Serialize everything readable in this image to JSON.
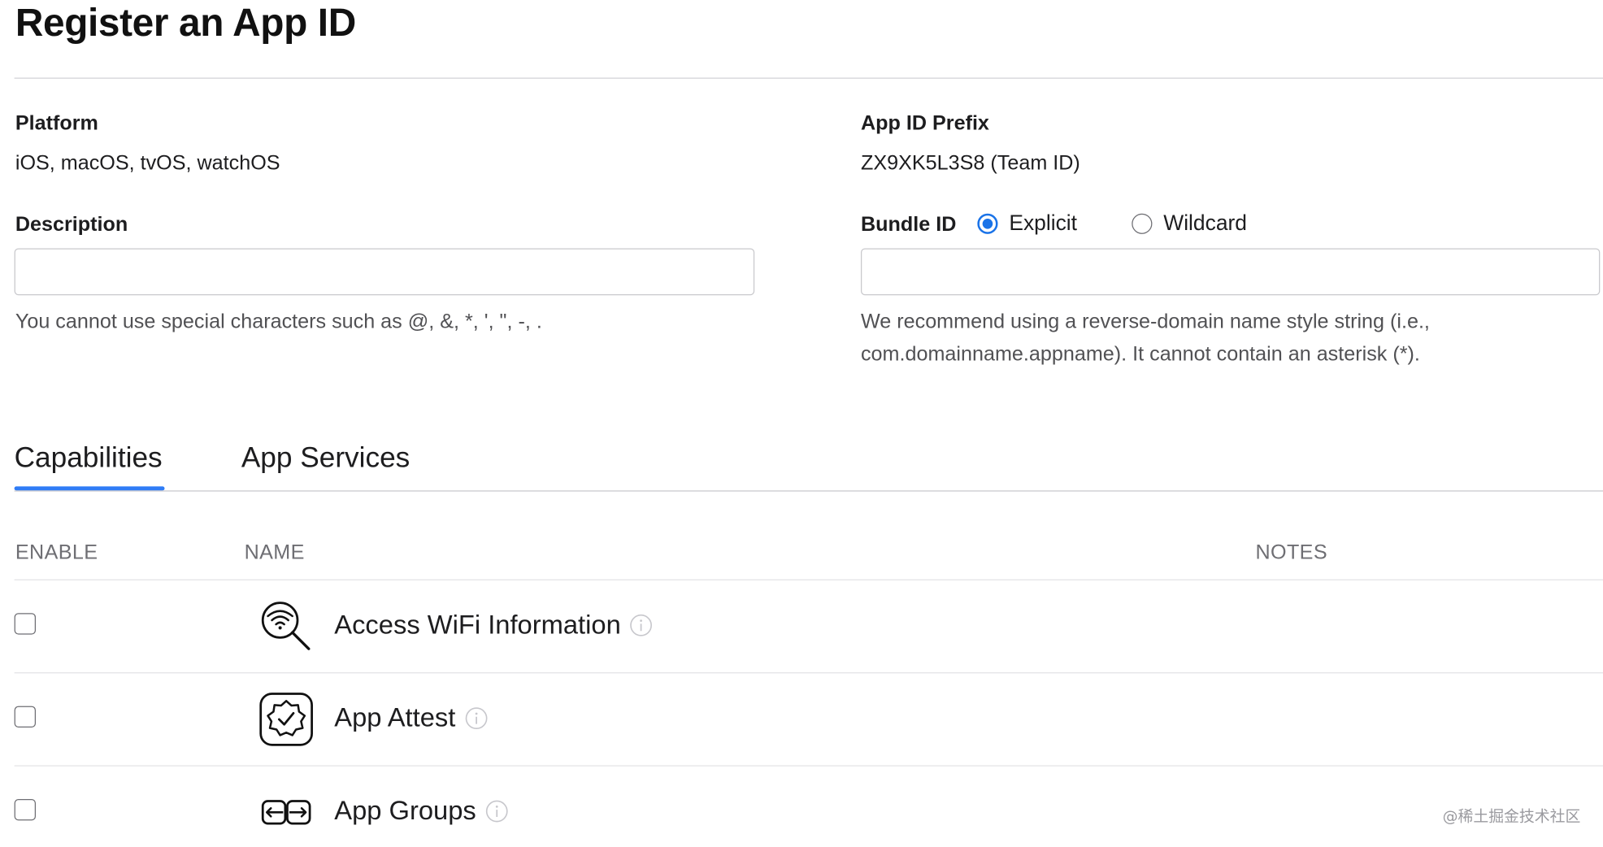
{
  "page": {
    "title": "Register an App ID"
  },
  "platform": {
    "label": "Platform",
    "value": "iOS, macOS, tvOS, watchOS"
  },
  "prefix": {
    "label": "App ID Prefix",
    "value": "ZX9XK5L3S8 (Team ID)"
  },
  "description": {
    "label": "Description",
    "value": "",
    "placeholder": "",
    "hint": "You cannot use special characters such as @, &, *, ', \", -, ."
  },
  "bundle": {
    "label": "Bundle ID",
    "explicit_label": "Explicit",
    "wildcard_label": "Wildcard",
    "selected": "Explicit",
    "value": "",
    "placeholder": "",
    "hint_line1": "We recommend using a reverse-domain name style string (i.e.,",
    "hint_line2": "com.domainname.appname). It cannot contain an asterisk (*)."
  },
  "tabs": [
    {
      "label": "Capabilities",
      "active": true
    },
    {
      "label": "App Services",
      "active": false
    }
  ],
  "table": {
    "headers": {
      "enable": "ENABLE",
      "name": "NAME",
      "notes": "NOTES"
    },
    "rows": [
      {
        "name": "Access WiFi Information",
        "icon": "wifi-search-icon",
        "enabled": false
      },
      {
        "name": "App Attest",
        "icon": "badge-check-icon",
        "enabled": false
      },
      {
        "name": "App Groups",
        "icon": "app-groups-icon",
        "enabled": false
      }
    ]
  },
  "watermark": "@稀土掘金技术社区",
  "colors": {
    "accent": "#2f7cf6",
    "radio_selected": "#1a73e8",
    "divider": "#d2d2d7",
    "muted_text": "#6e6e73"
  }
}
